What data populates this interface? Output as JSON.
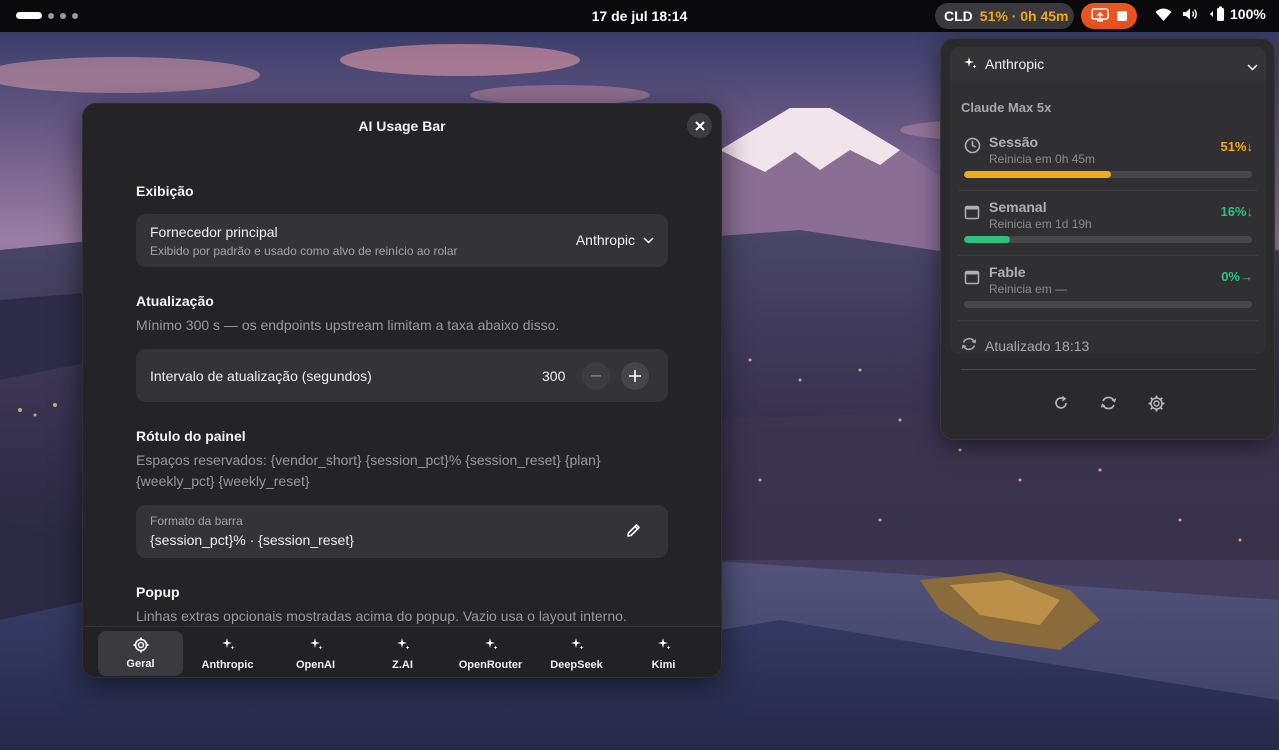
{
  "topbar": {
    "clock": "17 de jul  18:14",
    "indicator_name": "CLD",
    "indicator_value": "51% · 0h 45m",
    "battery": "100%"
  },
  "dialog": {
    "title": "AI Usage Bar",
    "sections": {
      "display": {
        "title": "Exibição",
        "vendor_label": "Fornecedor principal",
        "vendor_desc": "Exibido por padrão e usado como alvo de reinício ao rolar",
        "vendor_value": "Anthropic"
      },
      "refresh": {
        "title": "Atualização",
        "desc": "Mínimo 300 s — os endpoints upstream limitam a taxa abaixo disso.",
        "interval_label": "Intervalo de atualização (segundos)",
        "interval_value": "300"
      },
      "panel_label": {
        "title": "Rótulo do painel",
        "desc_line1": "Espaços reservados: {vendor_short} {session_pct}% {session_reset} {plan}",
        "desc_line2": "{weekly_pct} {weekly_reset}",
        "format_label": "Formato da barra",
        "format_value": "{session_pct}% · {session_reset}"
      },
      "popup": {
        "title": "Popup",
        "desc": "Linhas extras opcionais mostradas acima do popup. Vazio usa o layout interno."
      }
    },
    "tabs": [
      {
        "label": "Geral",
        "icon": "gear-icon",
        "active": true
      },
      {
        "label": "Anthropic",
        "icon": "sparkle-icon",
        "active": false
      },
      {
        "label": "OpenAI",
        "icon": "sparkle-icon",
        "active": false
      },
      {
        "label": "Z.AI",
        "icon": "sparkle-icon",
        "active": false
      },
      {
        "label": "OpenRouter",
        "icon": "sparkle-icon",
        "active": false
      },
      {
        "label": "DeepSeek",
        "icon": "sparkle-icon",
        "active": false
      },
      {
        "label": "Kimi",
        "icon": "sparkle-icon",
        "active": false
      }
    ]
  },
  "popup": {
    "vendor": "Anthropic",
    "plan": "Claude Max 5x",
    "metrics": [
      {
        "name": "Sessão",
        "reset": "Reinicia em 0h 45m",
        "pct": "51%",
        "trend": "↓",
        "fraction": 0.51,
        "color": "#f0a81c",
        "icon": "clock-icon"
      },
      {
        "name": "Semanal",
        "reset": "Reinicia em 1d 19h",
        "pct": "16%",
        "trend": "↓",
        "fraction": 0.16,
        "color": "#2ec27e",
        "icon": "calendar-icon"
      },
      {
        "name": "Fable",
        "reset": "Reinicia em —",
        "pct": "0%",
        "trend": "→",
        "fraction": 0.0,
        "color": "#2ec27e",
        "icon": "calendar-icon"
      }
    ],
    "updated": "Atualizado 18:13"
  }
}
